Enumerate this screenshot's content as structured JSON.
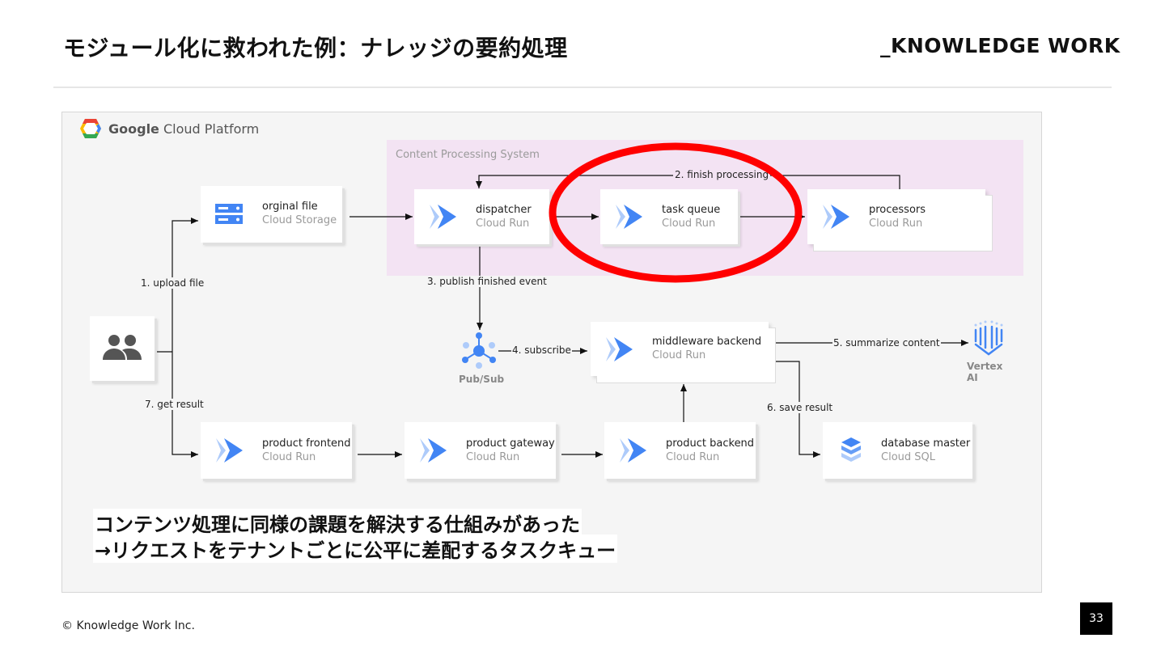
{
  "slide": {
    "title": "モジュール化に救われた例：ナレッジの要約処理",
    "brand": "_KNOWLEDGE WORK",
    "copyright": "© Knowledge Work Inc.",
    "page_number": "33"
  },
  "platform": {
    "brand_bold": "Google",
    "brand_rest": " Cloud Platform"
  },
  "group": {
    "label": "Content Processing System"
  },
  "nodes": {
    "original_file": {
      "name": "orginal file",
      "sub": "Cloud Storage",
      "icon": "storage-icon"
    },
    "dispatcher": {
      "name": "dispatcher",
      "sub": "Cloud Run",
      "icon": "cloud-run-icon"
    },
    "task_queue": {
      "name": "task queue",
      "sub": "Cloud Run",
      "icon": "cloud-run-icon"
    },
    "processors": {
      "name": "processors",
      "sub": "Cloud Run",
      "icon": "cloud-run-icon"
    },
    "middleware_backend": {
      "name": "middleware backend",
      "sub": "Cloud Run",
      "icon": "cloud-run-icon"
    },
    "product_frontend": {
      "name": "product frontend",
      "sub": "Cloud Run",
      "icon": "cloud-run-icon"
    },
    "product_gateway": {
      "name": "product gateway",
      "sub": "Cloud Run",
      "icon": "cloud-run-icon"
    },
    "product_backend": {
      "name": "product backend",
      "sub": "Cloud Run",
      "icon": "cloud-run-icon"
    },
    "database_master": {
      "name": "database master",
      "sub": "Cloud SQL",
      "icon": "cloud-sql-icon"
    },
    "pubsub": {
      "name": "Pub/Sub",
      "icon": "pubsub-icon"
    },
    "vertex": {
      "name": "Vertex AI",
      "icon": "vertex-ai-icon"
    },
    "users": {
      "icon": "users-icon"
    }
  },
  "edges": {
    "e1": "1. upload file",
    "e2": "2. finish processing",
    "e3": "3. publish finished event",
    "e4": "4. subscribe",
    "e5": "5. summarize content",
    "e6": "6. save result",
    "e7": "7. get result"
  },
  "caption": {
    "line1": "コンテンツ処理に同様の課題を解決する仕組みがあった",
    "line2": "→リクエストをテナントごとに公平に差配するタスクキュー"
  },
  "colors": {
    "highlight": "#ff0000",
    "group_bg": "#f3e3f3",
    "cloud_run_blue": "#4285f4"
  }
}
